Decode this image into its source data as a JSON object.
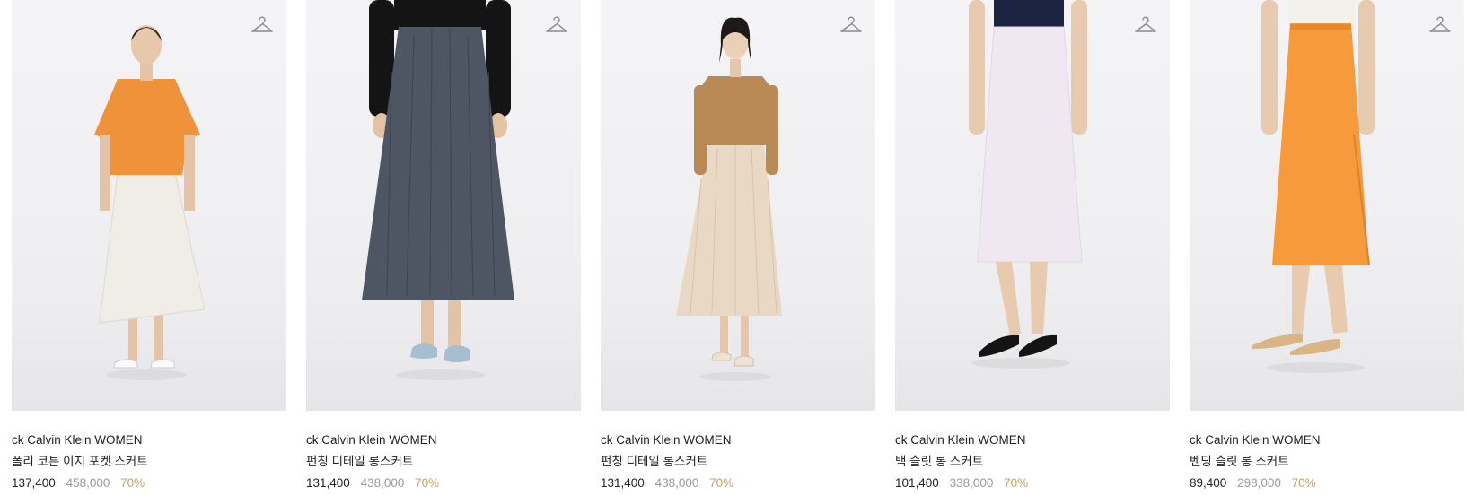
{
  "products": [
    {
      "brand": "ck Calvin Klein WOMEN",
      "name": "폴리 코튼 이지 포켓 스커트",
      "price": "137,400",
      "original_price": "458,000",
      "discount": "70%",
      "image_alt": "model wearing orange shirt and white skirt",
      "top_color": "#f0923a",
      "bottom_color": "#efede6"
    },
    {
      "brand": "ck Calvin Klein WOMEN",
      "name": "펀칭 디테일 롱스커트",
      "price": "131,400",
      "original_price": "438,000",
      "discount": "70%",
      "image_alt": "black top with navy grey long skirt",
      "top_color": "#141414",
      "bottom_color": "#4f5663"
    },
    {
      "brand": "ck Calvin Klein WOMEN",
      "name": "펀칭 디테일 롱스커트",
      "price": "131,400",
      "original_price": "438,000",
      "discount": "70%",
      "image_alt": "model wearing camel cardigan and beige skirt",
      "top_color": "#b98a55",
      "bottom_color": "#e9d9c4"
    },
    {
      "brand": "ck Calvin Klein WOMEN",
      "name": "백 슬릿 롱 스커트",
      "price": "101,400",
      "original_price": "338,000",
      "discount": "70%",
      "image_alt": "navy top with lavender white skirt",
      "top_color": "#1c2340",
      "bottom_color": "#efe8f3"
    },
    {
      "brand": "ck Calvin Klein WOMEN",
      "name": "벤딩 슬릿 롱 스커트",
      "price": "89,400",
      "original_price": "298,000",
      "discount": "70%",
      "image_alt": "white top with orange slit skirt",
      "top_color": "#f3f1ec",
      "bottom_color": "#f79a3c"
    }
  ],
  "icons": {
    "wishlist": "hanger-icon"
  },
  "colors": {
    "price": "#222222",
    "original_price": "#9a9a9a",
    "discount": "#c9a06b"
  }
}
